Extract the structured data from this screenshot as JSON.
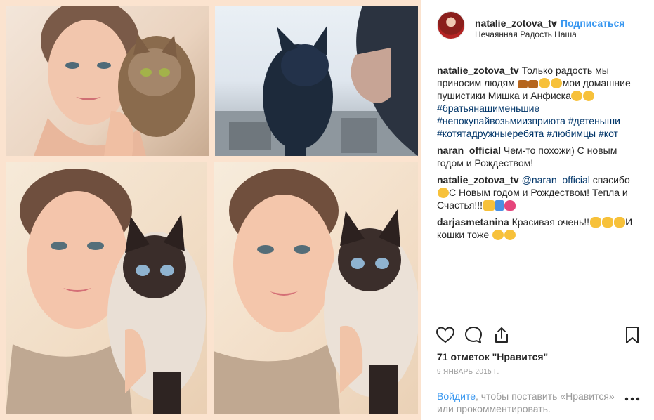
{
  "post": {
    "username": "natalie_zotova_tv",
    "dot": "•",
    "follow_label": "Подписаться",
    "location": "Нечаянная Радость Наша"
  },
  "comments": [
    {
      "user": "natalie_zotova_tv",
      "text_a": "Только радость мы приносим людям",
      "text_b": "мои домашние пушистики Мишка и Анфиска",
      "tags": "#братьянашименьшие #непокупайвозьмиизприюта #детеныши #котятадружныеребята #любимцы #кот"
    },
    {
      "user": "naran_official",
      "text": "Чем-то похожи) С новым годом и Рождеством!"
    },
    {
      "user": "natalie_zotova_tv",
      "mention": "@naran_official",
      "text_a": "спасибо",
      "text_b": "С Новым годом и Рождеством! Тепла и Счастья!!!"
    },
    {
      "user": "darjasmetanina",
      "text_a": "Красивая очень!!",
      "text_b": "И кошки тоже"
    }
  ],
  "actions": {
    "like_icon": "heart-outline-icon",
    "comment_icon": "speech-bubble-icon",
    "share_icon": "share-arrow-icon",
    "save_icon": "bookmark-icon"
  },
  "likes": "71 отметок \"Нравится\"",
  "date": "9 ЯНВАРЬ 2015 Г.",
  "footer": {
    "login_link": "Войдите",
    "login_text": ", чтобы поставить «Нравится» или прокомментировать.",
    "more_icon": "more-options-icon"
  },
  "colors": {
    "accent": "#3897f0",
    "hashtag": "#003569",
    "muted": "#999999",
    "photo_border": "#fbe3cf"
  }
}
